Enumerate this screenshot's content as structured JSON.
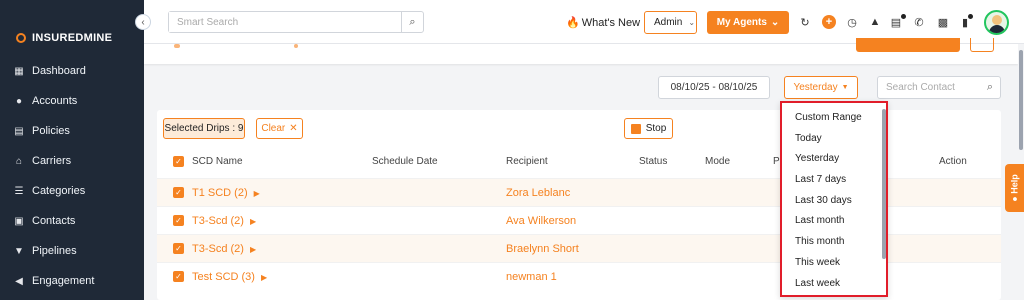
{
  "brand": {
    "name": "INSUREDMINE"
  },
  "sidebar": {
    "items": [
      {
        "label": "Dashboard",
        "icon": "dashboard-icon"
      },
      {
        "label": "Accounts",
        "icon": "accounts-icon"
      },
      {
        "label": "Policies",
        "icon": "policies-icon"
      },
      {
        "label": "Carriers",
        "icon": "carriers-icon"
      },
      {
        "label": "Categories",
        "icon": "categories-icon"
      },
      {
        "label": "Contacts",
        "icon": "contacts-icon"
      },
      {
        "label": "Pipelines",
        "icon": "pipelines-icon"
      },
      {
        "label": "Engagement",
        "icon": "engagement-icon"
      }
    ]
  },
  "header": {
    "search_placeholder": "Smart Search",
    "whats_new": "What's New",
    "role": "Admin",
    "agents_button": "My Agents"
  },
  "filters": {
    "date_range": "08/10/25 - 08/10/25",
    "period": "Yesterday",
    "contact_search_placeholder": "Search Contact"
  },
  "toolbar": {
    "selected_drips": "Selected Drips : 9",
    "clear": "Clear",
    "stop": "Stop"
  },
  "table": {
    "columns": [
      "SCD Name",
      "Schedule Date",
      "Recipient",
      "Status",
      "Mode",
      "Pr",
      "Action"
    ],
    "rows": [
      {
        "name": "T1 SCD (2)",
        "recipient": "Zora Leblanc"
      },
      {
        "name": "T3-Scd (2)",
        "recipient": "Ava Wilkerson"
      },
      {
        "name": "T3-Scd (2)",
        "recipient": "Braelynn Short"
      },
      {
        "name": "Test SCD (3)",
        "recipient": "newman 1"
      }
    ]
  },
  "period_dropdown": {
    "options": [
      "Custom Range",
      "Today",
      "Yesterday",
      "Last 7 days",
      "Last 30 days",
      "Last month",
      "This month",
      "This week",
      "Last week"
    ]
  },
  "help_tab": "Help",
  "colors": {
    "accent": "#f58220",
    "sidebar": "#1f2937",
    "highlight_border": "#e11d2a"
  }
}
